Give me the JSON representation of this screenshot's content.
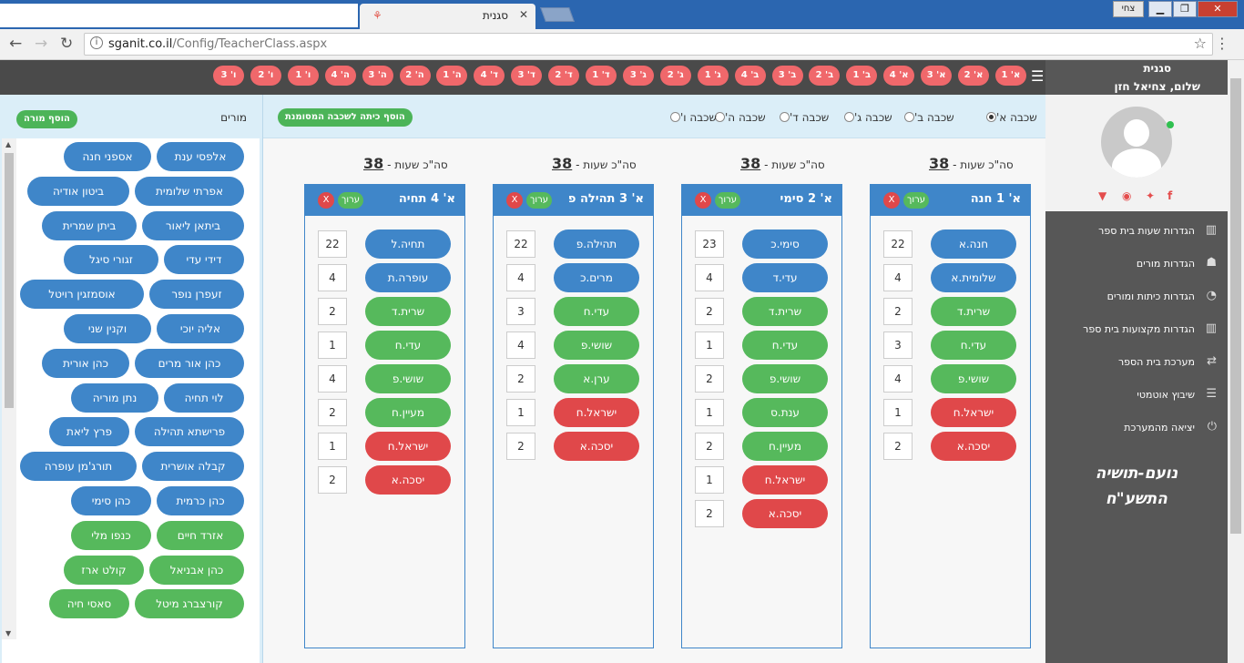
{
  "browser": {
    "tab_title": "סגנית",
    "user_label": "צחי",
    "url_host": "sganit.co.il",
    "url_path": "/Config/TeacherClass.aspx"
  },
  "sidebar": {
    "brand": "סגנית",
    "greeting": "שלום, צחיאל חזן",
    "menu": [
      {
        "label": "הגדרות שעות בית ספר",
        "icon": "bar-chart-icon"
      },
      {
        "label": "הגדרות מורים",
        "icon": "user-icon"
      },
      {
        "label": "הגדרות כיתות ומורים",
        "icon": "dashboard-icon"
      },
      {
        "label": "הגדרות מקצועות בית ספר",
        "icon": "bar-chart-icon"
      },
      {
        "label": "מערכת בית הספר",
        "icon": "exchange-icon"
      },
      {
        "label": "שיבוץ אוטמטי",
        "icon": "list-icon"
      },
      {
        "label": "יציאה מהמערכת",
        "icon": "power-icon"
      }
    ],
    "school_name": "נועם-תושיה",
    "school_year": "התשע\"ח"
  },
  "class_tabs": [
    "א' 1",
    "א' 2",
    "א' 3",
    "א' 4",
    "ב' 1",
    "ב' 2",
    "ב' 3",
    "ב' 4",
    "ג' 1",
    "ג' 2",
    "ג' 3",
    "ד' 1",
    "ד' 2",
    "ד' 3",
    "ד' 4",
    "ה' 1",
    "ה' 2",
    "ה' 3",
    "ה' 4",
    "ו' 1",
    "ו' 2",
    "ו' 3"
  ],
  "teachers_panel": {
    "title": "מורים",
    "add_button": "הוסף מורה",
    "teachers": [
      {
        "name": "אלפסי ענת",
        "color": "blue"
      },
      {
        "name": "אספני חנה",
        "color": "blue"
      },
      {
        "name": "אפרתי שלומית",
        "color": "blue"
      },
      {
        "name": "ביטון אודיה",
        "color": "blue"
      },
      {
        "name": "ביתאן ליאור",
        "color": "blue"
      },
      {
        "name": "ביתן שמרית",
        "color": "blue"
      },
      {
        "name": "דידי עדי",
        "color": "blue"
      },
      {
        "name": "זגורי סיגל",
        "color": "blue"
      },
      {
        "name": "זעפרן נופר",
        "color": "blue"
      },
      {
        "name": "אוסמזגין רויטל",
        "color": "blue"
      },
      {
        "name": "אליה יוכי",
        "color": "blue"
      },
      {
        "name": "וקנין שני",
        "color": "blue"
      },
      {
        "name": "כהן אור מרים",
        "color": "blue"
      },
      {
        "name": "כהן אורית",
        "color": "blue"
      },
      {
        "name": "לוי תחיה",
        "color": "blue"
      },
      {
        "name": "נתן מוריה",
        "color": "blue"
      },
      {
        "name": "פרישתא תהילה",
        "color": "blue"
      },
      {
        "name": "פרץ ליאת",
        "color": "blue"
      },
      {
        "name": "קבלה אושרית",
        "color": "blue"
      },
      {
        "name": "תורג'מן עופרה",
        "color": "blue"
      },
      {
        "name": "כהן כרמית",
        "color": "blue"
      },
      {
        "name": "כהן סימי",
        "color": "blue"
      },
      {
        "name": "אזרד חיים",
        "color": "green"
      },
      {
        "name": "כנפו מלי",
        "color": "green"
      },
      {
        "name": "כהן אבניאל",
        "color": "green"
      },
      {
        "name": "קולט ארז",
        "color": "green"
      },
      {
        "name": "קורצברג מיטל",
        "color": "green"
      },
      {
        "name": "סאסי חיה",
        "color": "green"
      }
    ]
  },
  "main": {
    "add_class_button": "הוסף כיתה לשכבה המסומנת",
    "layers": [
      {
        "label": "שכבה א'",
        "selected": true
      },
      {
        "label": "שכבה ב'",
        "selected": false
      },
      {
        "label": "שכבה ג'",
        "selected": false
      },
      {
        "label": "שכבה ד'",
        "selected": false
      },
      {
        "label": "שכבה ה'",
        "selected": false
      },
      {
        "label": "שכבה ו'",
        "selected": false
      }
    ],
    "total_label": "סה\"כ שעות -",
    "edit_label": "ערוך",
    "delete_label": "X",
    "classes": [
      {
        "name": "א' 1 חנה",
        "total": "38",
        "rows": [
          {
            "teacher": "חנה.א",
            "hours": "22",
            "color": "blue"
          },
          {
            "teacher": "שלומית.א",
            "hours": "4",
            "color": "blue"
          },
          {
            "teacher": "שרית.ד",
            "hours": "2",
            "color": "green"
          },
          {
            "teacher": "עדי.ח",
            "hours": "3",
            "color": "green"
          },
          {
            "teacher": "שושי.פ",
            "hours": "4",
            "color": "green"
          },
          {
            "teacher": "ישראל.ח",
            "hours": "1",
            "color": "red"
          },
          {
            "teacher": "יסכה.א",
            "hours": "2",
            "color": "red"
          }
        ]
      },
      {
        "name": "א' 2 סימי",
        "total": "38",
        "rows": [
          {
            "teacher": "סימי.כ",
            "hours": "23",
            "color": "blue"
          },
          {
            "teacher": "עדי.ד",
            "hours": "4",
            "color": "blue"
          },
          {
            "teacher": "שרית.ד",
            "hours": "2",
            "color": "green"
          },
          {
            "teacher": "עדי.ח",
            "hours": "1",
            "color": "green"
          },
          {
            "teacher": "שושי.פ",
            "hours": "2",
            "color": "green"
          },
          {
            "teacher": "ענת.ס",
            "hours": "1",
            "color": "green"
          },
          {
            "teacher": "מעיין.ח",
            "hours": "2",
            "color": "green"
          },
          {
            "teacher": "ישראל.ח",
            "hours": "1",
            "color": "red"
          },
          {
            "teacher": "יסכה.א",
            "hours": "2",
            "color": "red"
          }
        ]
      },
      {
        "name": "א' 3 תהילה פ",
        "total": "38",
        "rows": [
          {
            "teacher": "תהילה.פ",
            "hours": "22",
            "color": "blue"
          },
          {
            "teacher": "מרים.כ",
            "hours": "4",
            "color": "blue"
          },
          {
            "teacher": "עדי.ח",
            "hours": "3",
            "color": "green"
          },
          {
            "teacher": "שושי.פ",
            "hours": "4",
            "color": "green"
          },
          {
            "teacher": "ערן.א",
            "hours": "2",
            "color": "green"
          },
          {
            "teacher": "ישראל.ח",
            "hours": "1",
            "color": "red"
          },
          {
            "teacher": "יסכה.א",
            "hours": "2",
            "color": "red"
          }
        ]
      },
      {
        "name": "א' 4 תחיה",
        "total": "38",
        "rows": [
          {
            "teacher": "תחיה.ל",
            "hours": "22",
            "color": "blue"
          },
          {
            "teacher": "עופרה.ת",
            "hours": "4",
            "color": "blue"
          },
          {
            "teacher": "שרית.ד",
            "hours": "2",
            "color": "green"
          },
          {
            "teacher": "עדי.ח",
            "hours": "1",
            "color": "green"
          },
          {
            "teacher": "שושי.פ",
            "hours": "4",
            "color": "green"
          },
          {
            "teacher": "מעיין.ח",
            "hours": "2",
            "color": "green"
          },
          {
            "teacher": "ישראל.ח",
            "hours": "1",
            "color": "red"
          },
          {
            "teacher": "יסכה.א",
            "hours": "2",
            "color": "red"
          }
        ]
      }
    ]
  }
}
